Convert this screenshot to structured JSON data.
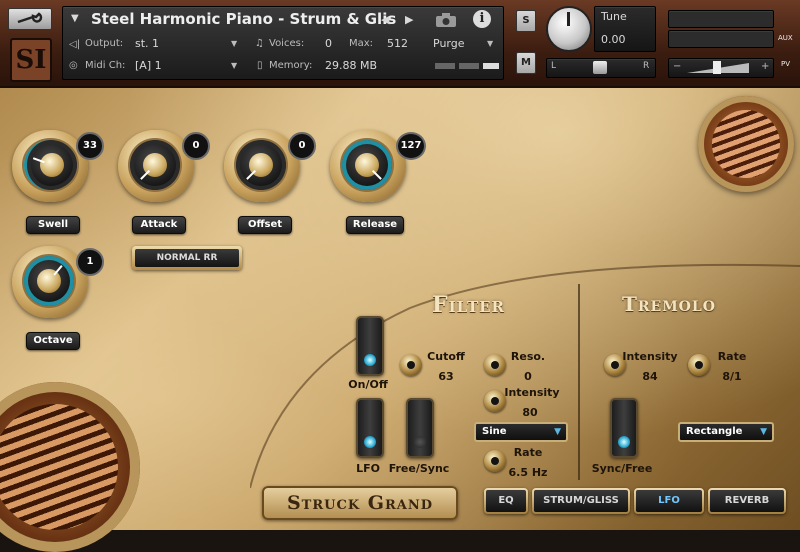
{
  "header": {
    "logo_text": "SI",
    "instrument_title": "Steel Harmonic Piano - Strum & Glis",
    "output_label": "Output:",
    "output_value": "st. 1",
    "voices_label": "Voices:",
    "voices_value": "0",
    "max_label": "Max:",
    "max_value": "512",
    "purge_label": "Purge",
    "midi_label": "Midi Ch:",
    "midi_value": "[A]  1",
    "memory_label": "Memory:",
    "memory_value": "29.88 MB",
    "solo_label": "S",
    "mute_label": "M",
    "tune_label": "Tune",
    "tune_value": "0.00",
    "pan_left": "L",
    "pan_right": "R",
    "aux_label": "AUX",
    "pv_label": "PV"
  },
  "knobs": {
    "swell": {
      "label": "Swell",
      "value": "33"
    },
    "attack": {
      "label": "Attack",
      "value": "0"
    },
    "offset": {
      "label": "Offset",
      "value": "0"
    },
    "release": {
      "label": "Release",
      "value": "127"
    },
    "octave": {
      "label": "Octave",
      "value": "1"
    }
  },
  "rr_button": "NORMAL RR",
  "filter": {
    "title": "Filter",
    "onoff_label": "On/Off",
    "cutoff_label": "Cutoff",
    "cutoff_value": "63",
    "reso_label": "Reso.",
    "reso_value": "0",
    "lfo_label": "LFO",
    "freesync_label": "Free/Sync",
    "intensity_label": "Intensity",
    "intensity_value": "80",
    "shape_value": "Sine",
    "rate_label": "Rate",
    "rate_value": "6.5 Hz"
  },
  "tremolo": {
    "title": "Tremolo",
    "intensity_label": "Intensity",
    "intensity_value": "84",
    "rate_label": "Rate",
    "rate_value": "8/1",
    "syncfree_label": "Sync/Free",
    "shape_value": "Rectangle"
  },
  "brand": "Struck Grand",
  "tabs": [
    {
      "label": "EQ"
    },
    {
      "label": "STRUM/GLISS"
    },
    {
      "label": "LFO"
    },
    {
      "label": "REVERB"
    }
  ],
  "colors": {
    "accent_teal": "#1f8fa3",
    "active_tab_text": "#6fc8ff",
    "brass": "#c29c5e"
  }
}
